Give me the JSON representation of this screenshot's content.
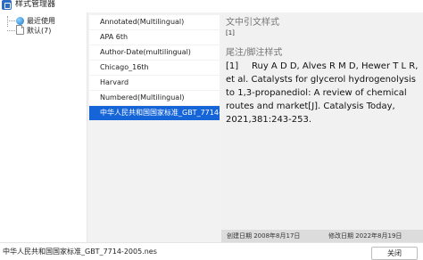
{
  "window": {
    "title": "样式管理器",
    "icon": "style-manager-icon"
  },
  "tree": {
    "items": [
      {
        "label": "最近使用",
        "icon": "globe-icon"
      },
      {
        "label": "默认(7)",
        "icon": "folder-icon"
      }
    ]
  },
  "styles": {
    "items": [
      "Annotated(Multilingual)",
      "APA 6th",
      "Author-Date(multilingual)",
      "Chicago_16th",
      "Harvard",
      "Numbered(Multilingual)",
      "中华人民共和国国家标准_GBT_7714-2005"
    ],
    "selected_index": 6
  },
  "preview": {
    "intext_heading": "文中引文样式",
    "intext_sample": "[1]",
    "footnote_heading": "尾注/脚注样式",
    "ref_number": "[1]",
    "ref_text": "Ruy A D D, Alves R M D, Hewer T L R, et al. Catalysts for glycerol hydrogenolysis to 1,3-propanediol: A review of chemical routes and market[J]. Catalysis Today, 2021,381:243-253."
  },
  "info": {
    "created": "创建日期  2008年8月17日",
    "modified": "修改日期  2022年8月19日"
  },
  "status": {
    "filename": "中华人民共和国国家标准_GBT_7714-2005.nes",
    "close_label": "关闭"
  }
}
